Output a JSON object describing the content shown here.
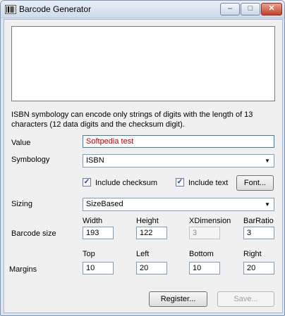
{
  "window": {
    "title": "Barcode Generator",
    "minimize": "–",
    "maximize": "□",
    "close": "✕"
  },
  "description": "ISBN symbology can encode only strings of digits with the length of 13 characters (12 data digits and the checksum digit).",
  "value": {
    "label": "Value",
    "text": "Softpedia test"
  },
  "symbology": {
    "label": "Symbology",
    "selected": "ISBN"
  },
  "options": {
    "include_checksum": "Include checksum",
    "include_checksum_checked": true,
    "include_text": "Include text",
    "include_text_checked": true,
    "font_button": "Font..."
  },
  "sizing": {
    "label": "Sizing",
    "selected": "SizeBased"
  },
  "barcode_size": {
    "label": "Barcode size",
    "width_label": "Width",
    "width": "193",
    "height_label": "Height",
    "height": "122",
    "xdim_label": "XDimension",
    "xdim": "3",
    "barratio_label": "BarRatio",
    "barratio": "3"
  },
  "margins": {
    "label": "Margins",
    "top_label": "Top",
    "top": "10",
    "left_label": "Left",
    "left": "20",
    "bottom_label": "Bottom",
    "bottom": "10",
    "right_label": "Right",
    "right": "20"
  },
  "buttons": {
    "register": "Register...",
    "save": "Save..."
  }
}
